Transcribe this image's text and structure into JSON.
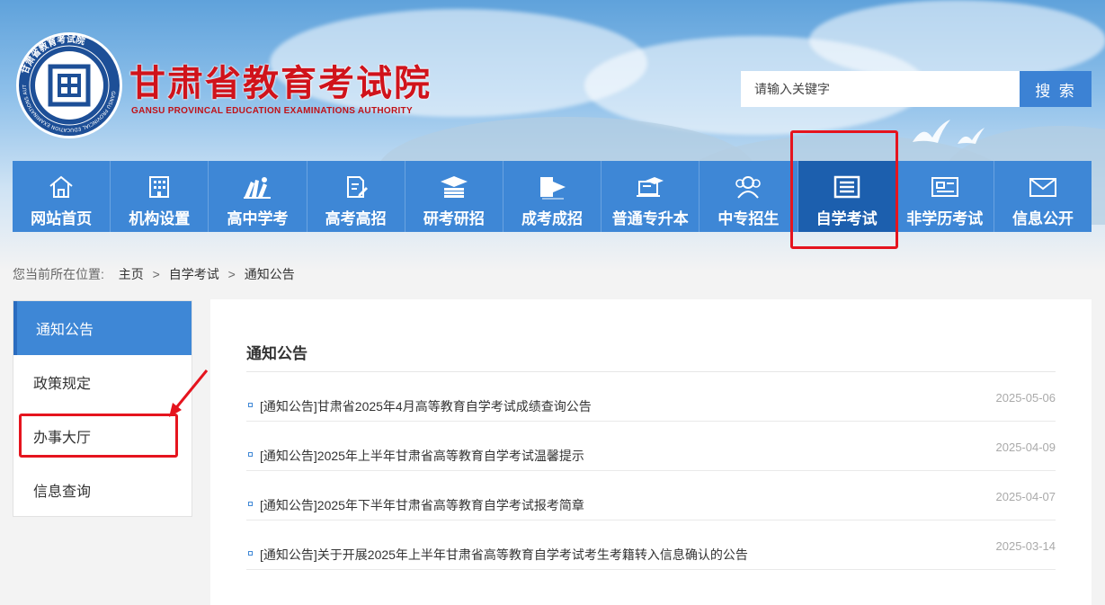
{
  "header": {
    "title": "甘肃省教育考试院",
    "subtitle": "GANSU PROVINCAL EDUCATION EXAMINATIONS AUTHORITY",
    "seal_text": "甘肃省教育考试院",
    "seal_text_en": "GANSU PROVINCIAL EDUCATION EXAMINATIONS AUTHORITY"
  },
  "search": {
    "placeholder": "请输入关键字",
    "button_label": "搜 索"
  },
  "nav": {
    "items": [
      {
        "label": "网站首页",
        "icon": "home-icon"
      },
      {
        "label": "机构设置",
        "icon": "building-icon"
      },
      {
        "label": "高中学考",
        "icon": "books-icon"
      },
      {
        "label": "高考高招",
        "icon": "document-pen-icon"
      },
      {
        "label": "研考研招",
        "icon": "graduation-cap-icon"
      },
      {
        "label": "成考成招",
        "icon": "book-flag-icon"
      },
      {
        "label": "普通专升本",
        "icon": "laptop-cap-icon"
      },
      {
        "label": "中专招生",
        "icon": "users-icon"
      },
      {
        "label": "自学考试",
        "icon": "notebook-icon",
        "active": true
      },
      {
        "label": "非学历考试",
        "icon": "id-card-icon"
      },
      {
        "label": "信息公开",
        "icon": "envelope-icon"
      }
    ]
  },
  "breadcrumb": {
    "prefix": "您当前所在位置:",
    "items": [
      "主页",
      "自学考试",
      "通知公告"
    ],
    "separator": ">"
  },
  "sidebar": {
    "items": [
      {
        "label": "通知公告",
        "active": true
      },
      {
        "label": "政策规定"
      },
      {
        "label": "办事大厅"
      },
      {
        "label": "信息查询"
      }
    ]
  },
  "main": {
    "title": "通知公告",
    "news": [
      {
        "title": "[通知公告]甘肃省2025年4月高等教育自学考试成绩查询公告",
        "date": "2025-05-06"
      },
      {
        "title": "[通知公告]2025年上半年甘肃省高等教育自学考试温馨提示",
        "date": "2025-04-09"
      },
      {
        "title": "[通知公告]2025年下半年甘肃省高等教育自学考试报考简章",
        "date": "2025-04-07"
      },
      {
        "title": "[通知公告]关于开展2025年上半年甘肃省高等教育自学考试考生考籍转入信息确认的公告",
        "date": "2025-03-14"
      }
    ]
  },
  "colors": {
    "brand_red": "#d0131b",
    "nav_blue": "#3e87d6",
    "nav_active": "#1c5fae",
    "highlight": "#e5141e"
  }
}
